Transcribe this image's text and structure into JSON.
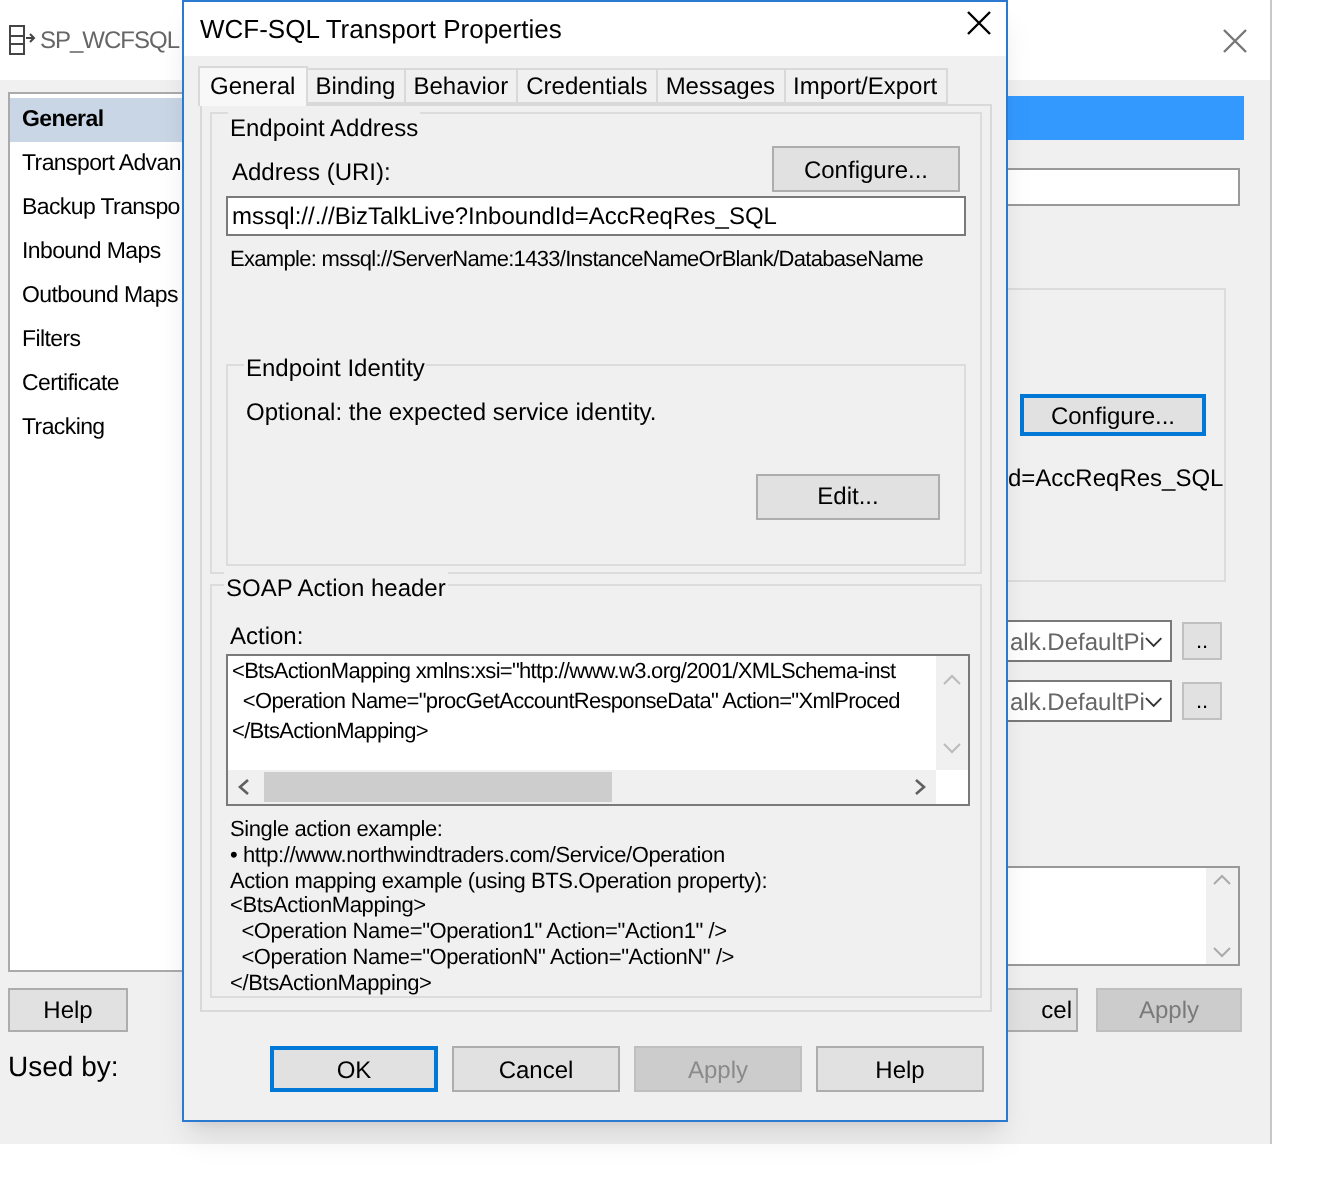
{
  "background_window": {
    "title": "SP_WCFSQL",
    "nav_items": [
      {
        "label": "General",
        "selected": true
      },
      {
        "label": "Transport Advan",
        "selected": false
      },
      {
        "label": "Backup Transpo",
        "selected": false
      },
      {
        "label": "Inbound Maps",
        "selected": false
      },
      {
        "label": "Outbound Maps",
        "selected": false
      },
      {
        "label": "Filters",
        "selected": false
      },
      {
        "label": "Certificate",
        "selected": false
      },
      {
        "label": "Tracking",
        "selected": false
      }
    ],
    "configure_button": {
      "label": "Configure...",
      "focused": true
    },
    "uri_fragment": "d=AccReqRes_SQL",
    "pipelines": [
      {
        "value": "alk.DefaultPi",
        "button": ".."
      },
      {
        "value": "alk.DefaultPi",
        "button": ".."
      }
    ],
    "buttons": [
      {
        "label": "Help",
        "disabled": false
      },
      {
        "label": "cel",
        "disabled": false
      },
      {
        "label": "Apply",
        "disabled": true
      }
    ],
    "used_by_label": "Used by:"
  },
  "dialog": {
    "title": "WCF-SQL Transport Properties",
    "tabs": [
      {
        "label": "General",
        "selected": true
      },
      {
        "label": "Binding",
        "selected": false
      },
      {
        "label": "Behavior",
        "selected": false
      },
      {
        "label": "Credentials",
        "selected": false
      },
      {
        "label": "Messages",
        "selected": false
      },
      {
        "label": "Import/Export",
        "selected": false
      }
    ],
    "endpoint_address": {
      "title": "Endpoint Address",
      "configure_button": "Configure...",
      "address_label": "Address (URI):",
      "address_value": "mssql://.//BizTalkLive?InboundId=AccReqRes_SQL",
      "example": "Example: mssql://ServerName:1433/InstanceNameOrBlank/DatabaseName"
    },
    "endpoint_identity": {
      "title": "Endpoint Identity",
      "description": "Optional: the expected service identity.",
      "edit_button": "Edit..."
    },
    "soap_action": {
      "title": "SOAP Action header",
      "action_label": "Action:",
      "action_lines": [
        "<BtsActionMapping xmlns:xsi=\"http://www.w3.org/2001/XMLSchema-inst",
        "  <Operation Name=\"procGetAccountResponseData\" Action=\"XmlProced",
        "</BtsActionMapping>"
      ],
      "help_lines": [
        "Single action example:",
        "• http://www.northwindtraders.com/Service/Operation",
        "Action mapping example (using BTS.Operation property):",
        "<BtsActionMapping>",
        "  <Operation Name=\"Operation1\" Action=\"Action1\" />",
        "  <Operation Name=\"OperationN\" Action=\"ActionN\" />",
        "</BtsActionMapping>"
      ]
    },
    "buttons": [
      {
        "label": "OK",
        "disabled": false,
        "focused": true
      },
      {
        "label": "Cancel",
        "disabled": false,
        "focused": false
      },
      {
        "label": "Apply",
        "disabled": true,
        "focused": false
      },
      {
        "label": "Help",
        "disabled": false,
        "focused": false
      }
    ]
  }
}
